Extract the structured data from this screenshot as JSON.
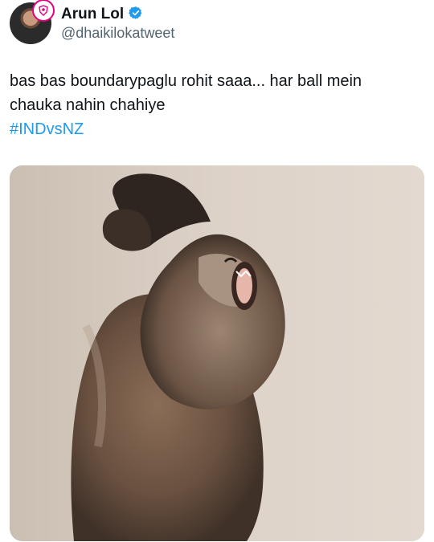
{
  "user": {
    "display_name": "Arun Lol",
    "handle": "@dhaikilokatweet",
    "verified_icon": "verified-badge-icon",
    "avatar_badge_icon": "team-crest-icon",
    "colors": {
      "verified": "#1d9bf0",
      "badge_ring": "#e6007e"
    }
  },
  "tweet": {
    "text_line1": "bas bas boundarypaglu rohit saaa... har ball mein",
    "text_line2": "chauka nahin chahiye",
    "hashtag": "#INDvsNZ",
    "hashtag_color": "#1d9bf0"
  },
  "media": {
    "alt": "monkey-screaming-image"
  }
}
